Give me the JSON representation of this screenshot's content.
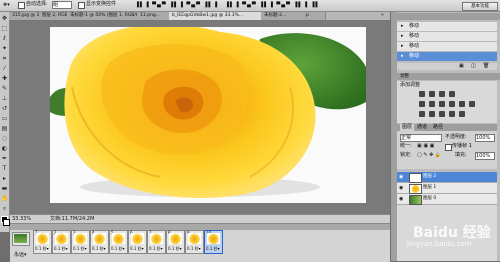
{
  "options_bar": {
    "auto_select_label": "自动选择:",
    "auto_select_value": "组",
    "show_transform_label": "显示变换控件",
    "workspace_button": "基本功能"
  },
  "doc_tabs": [
    {
      "label": "315.jpg @ 33.3%..."
    },
    {
      "label": "图层 2, RGB/8) *"
    },
    {
      "label": "未标题-1 @ 50% (图层 1, RGB/8) *"
    },
    {
      "label": "11.png..."
    },
    {
      "label": "b_IEEqpGVbBw1.jpg @ 33.3%..."
    },
    {
      "label": "未标题-2..."
    },
    {
      "label": "p"
    }
  ],
  "status_bar": {
    "zoom": "33.33%",
    "doc_info": "文档:11.7M/24.2M"
  },
  "history_panel": {
    "items": [
      {
        "label": "移动"
      },
      {
        "label": "移动"
      },
      {
        "label": "移动"
      },
      {
        "label": "移动"
      }
    ]
  },
  "adjustments_panel": {
    "title": "调整",
    "add_label": "添加调整"
  },
  "layers_panel": {
    "tabs": [
      "图层",
      "通道",
      "路径"
    ],
    "blend_mode": "正常",
    "opacity_label": "不透明度:",
    "opacity_value": "100%",
    "unify_label": "统一:",
    "propagate_label": "传播帧 1",
    "lock_label": "锁定:",
    "fill_label": "填充:",
    "fill_value": "100%",
    "layers": [
      {
        "name": "图层 2",
        "selected": true
      },
      {
        "name": "图层 1",
        "selected": false
      },
      {
        "name": "图层 0",
        "selected": false
      }
    ]
  },
  "animation": {
    "frames": [
      {
        "num": "1",
        "delay": "0.1 秒▾"
      },
      {
        "num": "2",
        "delay": "0.1 秒▾"
      },
      {
        "num": "3",
        "delay": "0.1 秒▾"
      },
      {
        "num": "4",
        "delay": "0.1 秒▾"
      },
      {
        "num": "5",
        "delay": "0.1 秒▾"
      },
      {
        "num": "6",
        "delay": "0.1 秒▾"
      },
      {
        "num": "7",
        "delay": "0.1 秒▾"
      },
      {
        "num": "8",
        "delay": "0.1 秒▾"
      },
      {
        "num": "9",
        "delay": "0.1 秒▾"
      },
      {
        "num": "10",
        "delay": "0.1 秒▾"
      }
    ],
    "loop": "永远▾"
  },
  "watermark": {
    "text": "Baidu 经验",
    "url": "jingyan.baidu.com"
  }
}
